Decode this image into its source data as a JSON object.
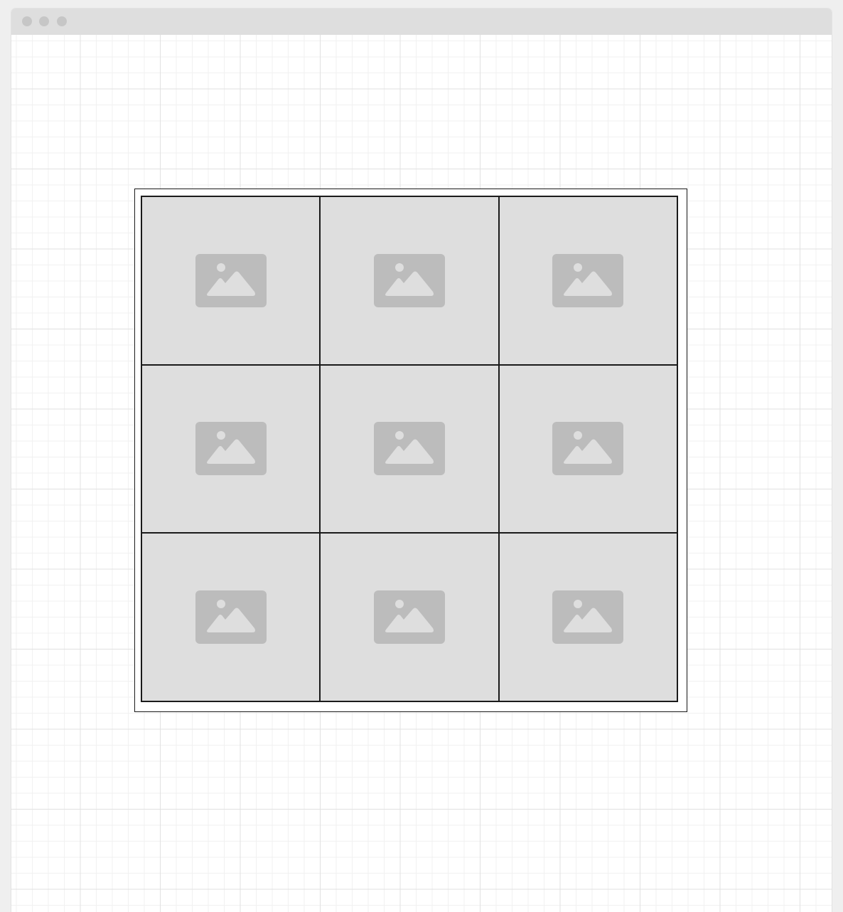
{
  "window": {
    "controls": [
      "window-dot",
      "window-dot",
      "window-dot"
    ]
  },
  "gallery": {
    "columns": 3,
    "rows": 3,
    "cells": [
      {
        "icon": "image-placeholder-icon"
      },
      {
        "icon": "image-placeholder-icon"
      },
      {
        "icon": "image-placeholder-icon"
      },
      {
        "icon": "image-placeholder-icon"
      },
      {
        "icon": "image-placeholder-icon"
      },
      {
        "icon": "image-placeholder-icon"
      },
      {
        "icon": "image-placeholder-icon"
      },
      {
        "icon": "image-placeholder-icon"
      },
      {
        "icon": "image-placeholder-icon"
      }
    ]
  },
  "colors": {
    "placeholder_fill": "#dedede",
    "icon_fill": "#bcbcbc",
    "grid_border": "#1a1a1a",
    "titlebar": "#dedede"
  }
}
